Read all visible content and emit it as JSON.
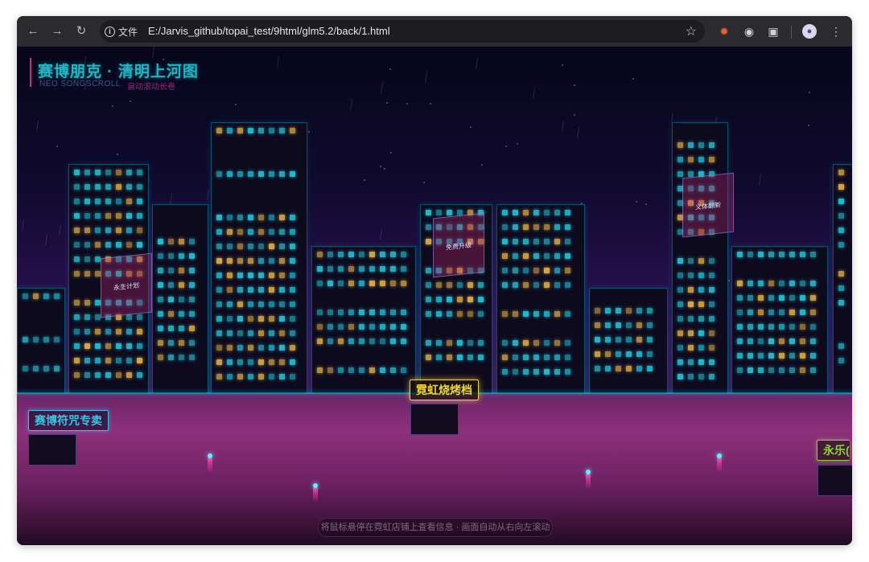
{
  "browser": {
    "info_chip_label": "文件",
    "url": "E:/Jarvis_github/topai_test/9html/glm5.2/back/1.html",
    "icons": [
      "back-icon",
      "forward-icon",
      "reload-icon",
      "info-icon",
      "star-icon",
      "extension-icon",
      "profile-icon",
      "menu-icon"
    ]
  },
  "page": {
    "title": "赛博朋克 · 清明上河图",
    "subtitle_en": "NEO SONGSCROLL",
    "subtitle_cn": "自动滚动长卷",
    "hint": "将鼠标悬停在霓虹店铺上查看信息 · 画面自动从右向左滚动"
  },
  "billboards": [
    {
      "label": "永生计划"
    },
    {
      "label": "免费升级"
    },
    {
      "label": "义体翻新"
    }
  ],
  "shops": [
    {
      "label": "赛博符咒专卖",
      "color": "#34c6e0"
    },
    {
      "label": "霓虹烧烤档",
      "color": "#f0d23c"
    },
    {
      "label": "永乐(",
      "color": "#8fcf3c"
    }
  ],
  "colors": {
    "window_cyan": "#1fc6d8",
    "window_yellow": "#e0b040",
    "neon_pink": "#ff40b0"
  }
}
